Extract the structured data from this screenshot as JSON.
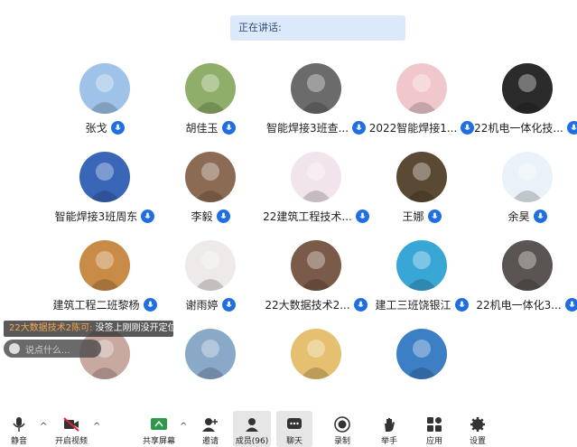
{
  "banner": {
    "speaking": "正在讲话:"
  },
  "participants": [
    {
      "name": "张戈",
      "avatar_color": "#9fc2e8"
    },
    {
      "name": "胡佳玉",
      "avatar_color": "#8fae6a"
    },
    {
      "name": "智能焊接3班查...",
      "avatar_color": "#6b6b6b"
    },
    {
      "name": "2022智能焊接1...",
      "avatar_color": "#f0c8cc"
    },
    {
      "name": "22机电一体化技...",
      "avatar_color": "#2b2b2b"
    },
    {
      "name": "智能焊接3班周东",
      "avatar_color": "#3a66b8"
    },
    {
      "name": "李毅",
      "avatar_color": "#8c6b55"
    },
    {
      "name": "22建筑工程技术...",
      "avatar_color": "#f2e4ec"
    },
    {
      "name": "王娜",
      "avatar_color": "#5b4a33"
    },
    {
      "name": "余昊",
      "avatar_color": "#e8f2f8"
    },
    {
      "name": "建筑工程二班黎杨",
      "avatar_color": "#c98b48"
    },
    {
      "name": "谢雨婷",
      "avatar_color": "#efeaea"
    },
    {
      "name": "22大数据技术2...",
      "avatar_color": "#7a5a48"
    },
    {
      "name": "建工三班饶银江",
      "avatar_color": "#39a7d6"
    },
    {
      "name": "22机电一体化3...",
      "avatar_color": "#5a5552"
    },
    {
      "name": "",
      "avatar_color": "#c7a9a0"
    },
    {
      "name": "",
      "avatar_color": "#8aa8c8"
    },
    {
      "name": "",
      "avatar_color": "#e5c070"
    },
    {
      "name": "",
      "avatar_color": "#3c7fc4"
    }
  ],
  "chat": {
    "sender": "22大数据技术2陈可:",
    "message": "没签上刚刚没开定位",
    "placeholder": "说点什么..."
  },
  "toolbar": {
    "mute": "静音",
    "video": "开启视频",
    "share": "共享屏幕",
    "invite": "邀请",
    "members": "成员(96)",
    "chat": "聊天",
    "record": "录制",
    "raise": "举手",
    "apps": "应用",
    "settings": "设置"
  },
  "colors": {
    "mic_badge": "#1f6fe0",
    "banner_bg": "#dce9fb",
    "active_tab_bg": "#e6e6e6"
  }
}
